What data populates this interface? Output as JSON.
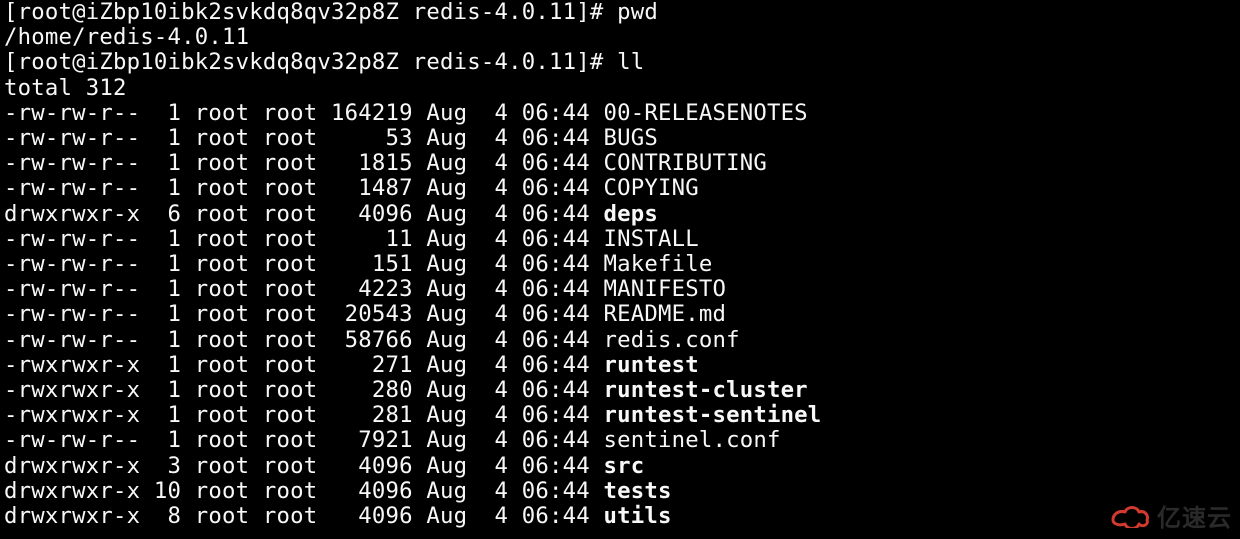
{
  "prompt": {
    "user": "root",
    "host": "iZbp10ibk2svkdq8qv32p8Z",
    "cwd_label": "redis-4.0.11",
    "symbol": "#"
  },
  "commands": {
    "pwd": "pwd",
    "ll": "ll"
  },
  "pwd_output": "/home/redis-4.0.11",
  "total_line": "total 312",
  "listing": [
    {
      "perm": "-rw-rw-r--",
      "links": " 1",
      "owner": "root",
      "group": "root",
      "size": "164219",
      "month": "Aug",
      "day": " 4",
      "time": "06:44",
      "name": "00-RELEASENOTES",
      "bold": false
    },
    {
      "perm": "-rw-rw-r--",
      "links": " 1",
      "owner": "root",
      "group": "root",
      "size": "    53",
      "month": "Aug",
      "day": " 4",
      "time": "06:44",
      "name": "BUGS",
      "bold": false
    },
    {
      "perm": "-rw-rw-r--",
      "links": " 1",
      "owner": "root",
      "group": "root",
      "size": "  1815",
      "month": "Aug",
      "day": " 4",
      "time": "06:44",
      "name": "CONTRIBUTING",
      "bold": false
    },
    {
      "perm": "-rw-rw-r--",
      "links": " 1",
      "owner": "root",
      "group": "root",
      "size": "  1487",
      "month": "Aug",
      "day": " 4",
      "time": "06:44",
      "name": "COPYING",
      "bold": false
    },
    {
      "perm": "drwxrwxr-x",
      "links": " 6",
      "owner": "root",
      "group": "root",
      "size": "  4096",
      "month": "Aug",
      "day": " 4",
      "time": "06:44",
      "name": "deps",
      "bold": true
    },
    {
      "perm": "-rw-rw-r--",
      "links": " 1",
      "owner": "root",
      "group": "root",
      "size": "    11",
      "month": "Aug",
      "day": " 4",
      "time": "06:44",
      "name": "INSTALL",
      "bold": false
    },
    {
      "perm": "-rw-rw-r--",
      "links": " 1",
      "owner": "root",
      "group": "root",
      "size": "   151",
      "month": "Aug",
      "day": " 4",
      "time": "06:44",
      "name": "Makefile",
      "bold": false
    },
    {
      "perm": "-rw-rw-r--",
      "links": " 1",
      "owner": "root",
      "group": "root",
      "size": "  4223",
      "month": "Aug",
      "day": " 4",
      "time": "06:44",
      "name": "MANIFESTO",
      "bold": false
    },
    {
      "perm": "-rw-rw-r--",
      "links": " 1",
      "owner": "root",
      "group": "root",
      "size": " 20543",
      "month": "Aug",
      "day": " 4",
      "time": "06:44",
      "name": "README.md",
      "bold": false
    },
    {
      "perm": "-rw-rw-r--",
      "links": " 1",
      "owner": "root",
      "group": "root",
      "size": " 58766",
      "month": "Aug",
      "day": " 4",
      "time": "06:44",
      "name": "redis.conf",
      "bold": false
    },
    {
      "perm": "-rwxrwxr-x",
      "links": " 1",
      "owner": "root",
      "group": "root",
      "size": "   271",
      "month": "Aug",
      "day": " 4",
      "time": "06:44",
      "name": "runtest",
      "bold": true
    },
    {
      "perm": "-rwxrwxr-x",
      "links": " 1",
      "owner": "root",
      "group": "root",
      "size": "   280",
      "month": "Aug",
      "day": " 4",
      "time": "06:44",
      "name": "runtest-cluster",
      "bold": true
    },
    {
      "perm": "-rwxrwxr-x",
      "links": " 1",
      "owner": "root",
      "group": "root",
      "size": "   281",
      "month": "Aug",
      "day": " 4",
      "time": "06:44",
      "name": "runtest-sentinel",
      "bold": true
    },
    {
      "perm": "-rw-rw-r--",
      "links": " 1",
      "owner": "root",
      "group": "root",
      "size": "  7921",
      "month": "Aug",
      "day": " 4",
      "time": "06:44",
      "name": "sentinel.conf",
      "bold": false
    },
    {
      "perm": "drwxrwxr-x",
      "links": " 3",
      "owner": "root",
      "group": "root",
      "size": "  4096",
      "month": "Aug",
      "day": " 4",
      "time": "06:44",
      "name": "src",
      "bold": true
    },
    {
      "perm": "drwxrwxr-x",
      "links": "10",
      "owner": "root",
      "group": "root",
      "size": "  4096",
      "month": "Aug",
      "day": " 4",
      "time": "06:44",
      "name": "tests",
      "bold": true
    },
    {
      "perm": "drwxrwxr-x",
      "links": " 8",
      "owner": "root",
      "group": "root",
      "size": "  4096",
      "month": "Aug",
      "day": " 4",
      "time": "06:44",
      "name": "utils",
      "bold": true
    }
  ],
  "watermark": {
    "text": "亿速云",
    "logo_color": "#d33a2f"
  }
}
